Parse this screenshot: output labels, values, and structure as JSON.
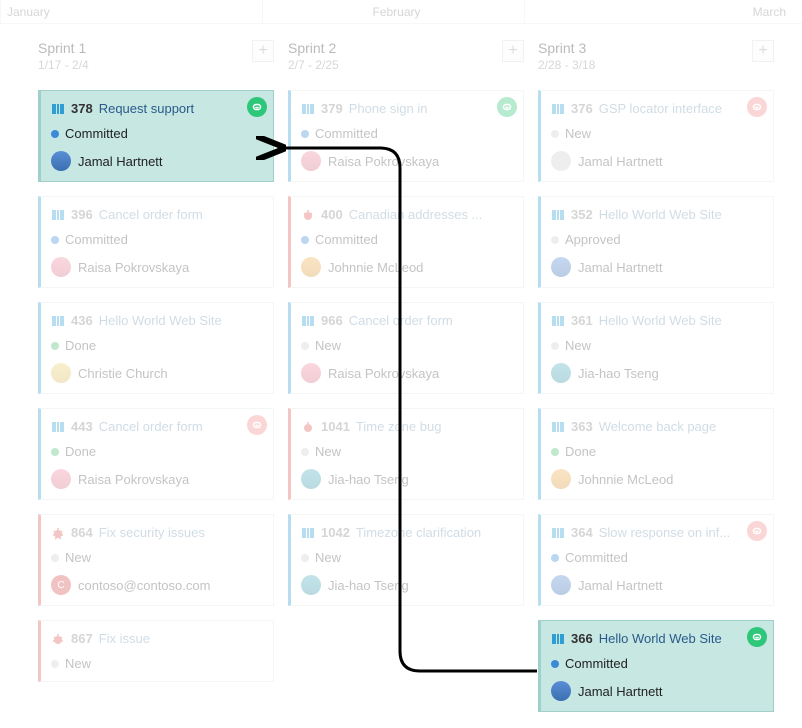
{
  "months": [
    "January",
    "February",
    "March"
  ],
  "sprints": [
    {
      "name": "Sprint 1",
      "dates": "1/17 - 2/4"
    },
    {
      "name": "Sprint 2",
      "dates": "2/7 - 2/25"
    },
    {
      "name": "Sprint 3",
      "dates": "2/28 - 3/18"
    }
  ],
  "cards": {
    "c378": {
      "id": "378",
      "title": "Request support",
      "state": "Committed",
      "person": "Jamal Hartnett"
    },
    "c396": {
      "id": "396",
      "title": "Cancel order form",
      "state": "Committed",
      "person": "Raisa Pokrovskaya"
    },
    "c436": {
      "id": "436",
      "title": "Hello World Web Site",
      "state": "Done",
      "person": "Christie Church"
    },
    "c443": {
      "id": "443",
      "title": "Cancel order form",
      "state": "Done",
      "person": "Raisa Pokrovskaya"
    },
    "c864": {
      "id": "864",
      "title": "Fix security issues",
      "state": "New",
      "person": "contoso@contoso.com"
    },
    "c867": {
      "id": "867",
      "title": "Fix issue",
      "state": "New",
      "person": ""
    },
    "c379": {
      "id": "379",
      "title": "Phone sign in",
      "state": "Committed",
      "person": "Raisa Pokrovskaya"
    },
    "c400": {
      "id": "400",
      "title": "Canadian addresses ...",
      "state": "Committed",
      "person": "Johnnie McLeod"
    },
    "c966": {
      "id": "966",
      "title": "Cancel order form",
      "state": "New",
      "person": "Raisa Pokrovskaya"
    },
    "c1041": {
      "id": "1041",
      "title": "Time zone bug",
      "state": "New",
      "person": "Jia-hao Tseng"
    },
    "c1042": {
      "id": "1042",
      "title": "Timezone clarification",
      "state": "New",
      "person": "Jia-hao Tseng"
    },
    "c376": {
      "id": "376",
      "title": "GSP locator interface",
      "state": "New",
      "person": "Jamal Hartnett"
    },
    "c352": {
      "id": "352",
      "title": "Hello World Web Site",
      "state": "Approved",
      "person": "Jamal Hartnett"
    },
    "c361": {
      "id": "361",
      "title": "Hello World Web Site",
      "state": "New",
      "person": "Jia-hao Tseng"
    },
    "c363": {
      "id": "363",
      "title": "Welcome back page",
      "state": "Done",
      "person": "Johnnie McLeod"
    },
    "c364": {
      "id": "364",
      "title": "Slow response on inf...",
      "state": "Committed",
      "person": "Jamal Hartnett"
    },
    "c366": {
      "id": "366",
      "title": "Hello World Web Site",
      "state": "Committed",
      "person": "Jamal Hartnett"
    }
  }
}
